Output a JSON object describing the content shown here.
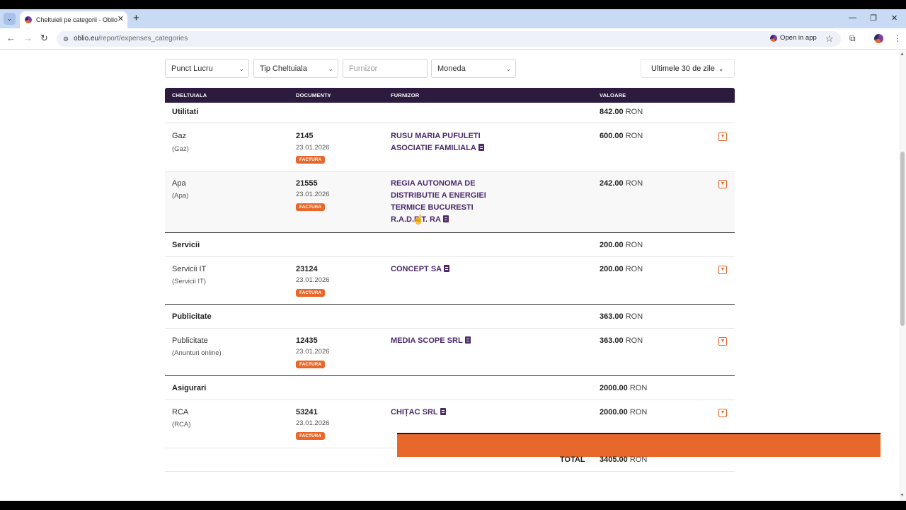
{
  "browser": {
    "tab_title": "Cheltuieli pe categorii - Oblio",
    "url_domain": "oblio.eu",
    "url_path": "/report/expenses_categories",
    "open_in_app": "Open in app"
  },
  "filters": {
    "punct_lucru": "Punct Lucru",
    "tip_cheltuiala": "Tip Cheltuiala",
    "furnizor_placeholder": "Furnizor",
    "moneda": "Moneda",
    "period": "Ultimele 30 de zile"
  },
  "table": {
    "headers": [
      "CHELTUIALA",
      "DOCUMENT#",
      "FURNIZOR",
      "VALOARE"
    ],
    "currency": "RON",
    "categories": [
      {
        "name": "Utilitati",
        "total": "842.00",
        "items": [
          {
            "name": "Gaz",
            "sub": "(Gaz)",
            "doc": "2145",
            "date": "23.01.2026",
            "badge": "FACTURA",
            "supplier_lines": [
              "RUSU MARIA PUFULETI",
              "ASOCIATIE FAMILIALA"
            ],
            "value": "600.00"
          },
          {
            "name": "Apa",
            "sub": "(Apa)",
            "doc": "21555",
            "date": "23.01.2026",
            "badge": "FACTURA",
            "supplier_lines": [
              "REGIA AUTONOMA DE",
              "DISTRIBUTIE A ENERGIEI",
              "TERMICE BUCURESTI",
              "R.A.D.E.T. RA"
            ],
            "value": "242.00"
          }
        ]
      },
      {
        "name": "Servicii",
        "total": "200.00",
        "items": [
          {
            "name": "Servicii IT",
            "sub": "(Servicii IT)",
            "doc": "23124",
            "date": "23.01.2026",
            "badge": "FACTURA",
            "supplier_lines": [
              "CONCEPT SA"
            ],
            "value": "200.00"
          }
        ]
      },
      {
        "name": "Publicitate",
        "total": "363.00",
        "items": [
          {
            "name": "Publicitate",
            "sub": "(Anunturi online)",
            "doc": "12435",
            "date": "23.01.2026",
            "badge": "FACTURA",
            "supplier_lines": [
              "MEDIA SCOPE SRL"
            ],
            "value": "363.00"
          }
        ]
      },
      {
        "name": "Asigurari",
        "total": "2000.00",
        "items": [
          {
            "name": "RCA",
            "sub": "(RCA)",
            "doc": "53241",
            "date": "23.01.2026",
            "badge": "FACTURA",
            "supplier_lines": [
              "CHIȚAC SRL"
            ],
            "value": "2000.00"
          }
        ]
      }
    ],
    "total_label": "TOTAL",
    "total_value": "3405.00"
  },
  "colors": {
    "header_bg": "#2c1b3f",
    "accent_orange": "#e8672a",
    "supplier_purple": "#4b2a6b"
  }
}
